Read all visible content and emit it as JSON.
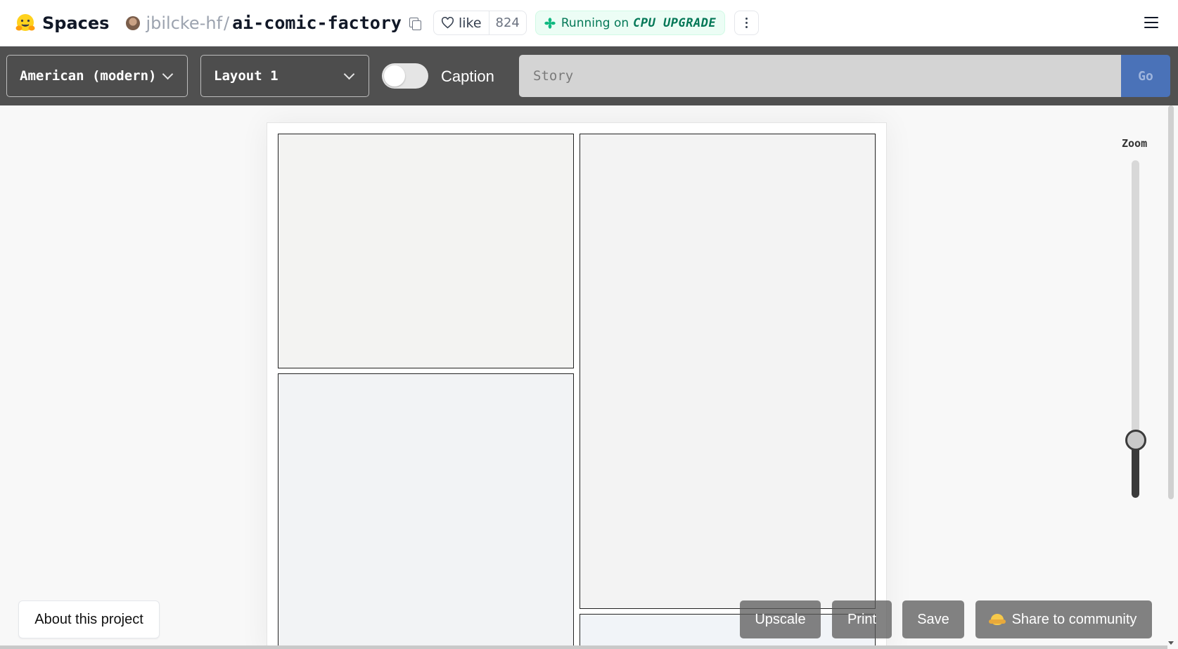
{
  "header": {
    "spaces_label": "Spaces",
    "owner": "jbilcke-hf",
    "separator": "/",
    "repo": "ai-comic-factory",
    "like_label": "like",
    "like_count": "824",
    "status_prefix": "Running on",
    "status_hardware": "CPU UPGRADE",
    "status_color": "#047857"
  },
  "toolbar": {
    "style_select": "American (modern)",
    "layout_select": "Layout 1",
    "caption_label": "Caption",
    "caption_enabled": false,
    "story_placeholder": "Story",
    "story_value": "",
    "go_label": "Go",
    "go_color": "#4a72b8"
  },
  "comic": {
    "panels_count": 4
  },
  "zoom": {
    "label": "Zoom",
    "level_fraction": 0.17
  },
  "footer": {
    "about_label": "About this project",
    "upscale_label": "Upscale",
    "print_label": "Print",
    "save_label": "Save",
    "share_label": "Share to community"
  }
}
